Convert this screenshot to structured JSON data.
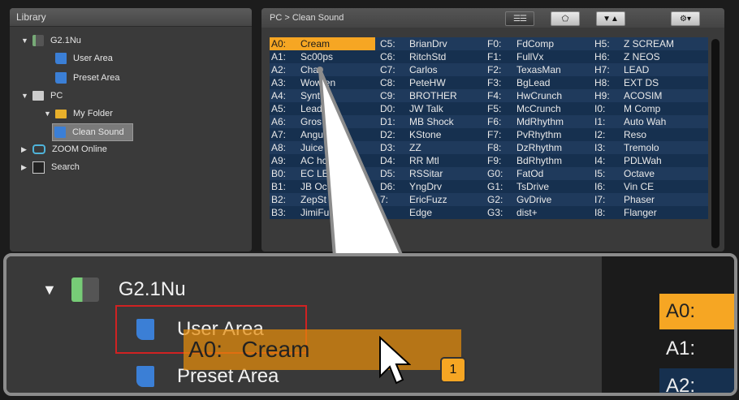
{
  "library": {
    "title": "Library",
    "tree": [
      {
        "label": "G2.1Nu",
        "icon": "device-icon",
        "expanded": true
      },
      {
        "label": "User Area",
        "icon": "document-icon"
      },
      {
        "label": "Preset Area",
        "icon": "document-icon"
      },
      {
        "label": "PC",
        "icon": "computer-icon",
        "expanded": true
      },
      {
        "label": "My Folder",
        "icon": "folder-icon",
        "expanded": true
      },
      {
        "label": "Clean Sound",
        "icon": "document-icon",
        "selected": true
      },
      {
        "label": "ZOOM Online",
        "icon": "cloud-icon",
        "expanded": false
      },
      {
        "label": "Search",
        "icon": "search-icon",
        "expanded": false
      }
    ]
  },
  "main": {
    "breadcrumb": "PC > Clean Sound",
    "toolbar": {
      "view_list_icon": "list-view-icon",
      "view_effect_icon": "pentagon-icon",
      "sort_icon": "sort-icon",
      "settings_icon": "gear-icon"
    },
    "patches": [
      [
        {
          "code": "A0:",
          "name": "Cream",
          "highlight": true
        },
        {
          "code": "C5:",
          "name": "BrianDrv"
        },
        {
          "code": "F0:",
          "name": "FdComp"
        },
        {
          "code": "H5:",
          "name": "Z SCREAM"
        }
      ],
      [
        {
          "code": "A1:",
          "name": "Sc00ps"
        },
        {
          "code": "C6:",
          "name": "RitchStd"
        },
        {
          "code": "F1:",
          "name": "FullVx"
        },
        {
          "code": "H6:",
          "name": "Z NEOS"
        }
      ],
      [
        {
          "code": "A2:",
          "name": "Cha"
        },
        {
          "code": "C7:",
          "name": "Carlos"
        },
        {
          "code": "F2:",
          "name": "TexasMan"
        },
        {
          "code": "H7:",
          "name": "LEAD"
        }
      ],
      [
        {
          "code": "A3:",
          "name": "Wow en"
        },
        {
          "code": "C8:",
          "name": "PeteHW"
        },
        {
          "code": "F3:",
          "name": "BgLead"
        },
        {
          "code": "H8:",
          "name": "EXT DS"
        }
      ],
      [
        {
          "code": "A4:",
          "name": "Synt h"
        },
        {
          "code": "C9:",
          "name": "BROTHER"
        },
        {
          "code": "F4:",
          "name": "HwCrunch"
        },
        {
          "code": "H9:",
          "name": "ACOSIM"
        }
      ],
      [
        {
          "code": "A5:",
          "name": "Lead"
        },
        {
          "code": "D0:",
          "name": "JW Talk"
        },
        {
          "code": "F5:",
          "name": "McCrunch"
        },
        {
          "code": "I0:",
          "name": "M Comp"
        }
      ],
      [
        {
          "code": "A6:",
          "name": "Gros"
        },
        {
          "code": "D1:",
          "name": "MB Shock"
        },
        {
          "code": "F6:",
          "name": "MdRhythm"
        },
        {
          "code": "I1:",
          "name": "Auto Wah"
        }
      ],
      [
        {
          "code": "A7:",
          "name": "Angu"
        },
        {
          "code": "D2:",
          "name": "KStone"
        },
        {
          "code": "F7:",
          "name": "PvRhythm"
        },
        {
          "code": "I2:",
          "name": "Reso"
        }
      ],
      [
        {
          "code": "A8:",
          "name": "Juice"
        },
        {
          "code": "D3:",
          "name": "ZZ"
        },
        {
          "code": "F8:",
          "name": "DzRhythm"
        },
        {
          "code": "I3:",
          "name": "Tremolo"
        }
      ],
      [
        {
          "code": "A9:",
          "name": "AC hc"
        },
        {
          "code": "D4:",
          "name": "RR Mtl"
        },
        {
          "code": "F9:",
          "name": "BdRhythm"
        },
        {
          "code": "I4:",
          "name": "PDLWah"
        }
      ],
      [
        {
          "code": "B0:",
          "name": "EC LE"
        },
        {
          "code": "D5:",
          "name": "RSSitar"
        },
        {
          "code": "G0:",
          "name": "FatOd"
        },
        {
          "code": "I5:",
          "name": "Octave"
        }
      ],
      [
        {
          "code": "B1:",
          "name": "JB Oc"
        },
        {
          "code": "D6:",
          "name": "YngDrv"
        },
        {
          "code": "G1:",
          "name": "TsDrive"
        },
        {
          "code": "I6:",
          "name": "Vin CE"
        }
      ],
      [
        {
          "code": "B2:",
          "name": "ZepSt"
        },
        {
          "code": "7:",
          "name": "EricFuzz"
        },
        {
          "code": "G2:",
          "name": "GvDrive"
        },
        {
          "code": "I7:",
          "name": "Phaser"
        }
      ],
      [
        {
          "code": "B3:",
          "name": "JimiFu"
        },
        {
          "code": "",
          "name": "Edge"
        },
        {
          "code": "G3:",
          "name": "dist+"
        },
        {
          "code": "I8:",
          "name": "Flanger"
        }
      ]
    ]
  },
  "callout": {
    "device": "G2.1Nu",
    "user_area": "User Area",
    "preset_area": "Preset Area",
    "drag_code": "A0:",
    "drag_name": "Cream",
    "badge": "1",
    "codes": [
      "A0:",
      "A1:",
      "A2:"
    ]
  },
  "colors": {
    "accent": "#f6a623",
    "row_dark": "#1f3a5c",
    "row_light": "#16304f",
    "highlight": "#f6a623"
  }
}
